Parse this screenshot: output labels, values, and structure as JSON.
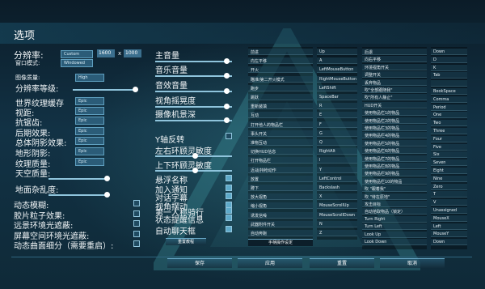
{
  "title": "选项",
  "video": {
    "resolution_label": "分辨率:",
    "resolution_mode": "Custom",
    "width": "1600",
    "x": "x",
    "height": "1000",
    "window_mode_label": "窗口模式:",
    "window_mode": "Windowed",
    "graphics_quality_label": "图像质量:",
    "graphics_quality": "High",
    "resolution_scale_label": "分辨率等级:"
  },
  "detail_settings": [
    {
      "label": "世界纹理缓存",
      "value": "Epic"
    },
    {
      "label": "视距:",
      "value": "Epic"
    },
    {
      "label": "抗锯齿:",
      "value": "Epic"
    },
    {
      "label": "后期效果:",
      "value": "Epic"
    },
    {
      "label": "总体阴影效果:",
      "value": "Epic"
    },
    {
      "label": "地形阴影:",
      "value": "Epic"
    },
    {
      "label": "纹理质量:",
      "value": "Epic"
    },
    {
      "label": "天空质量:",
      "value": ""
    },
    {
      "label": "地面杂乱度:",
      "value": ""
    }
  ],
  "left_toggles": [
    "动态模糊:",
    "胶片粒子效果:",
    "远景环境光遮蔽:",
    "屏幕空间环境光遮蔽:",
    "动态曲面细分（需要重启）:"
  ],
  "audio": [
    "主音量",
    "音乐音量",
    "音效音量",
    "视角摇晃度",
    "摄像机景深"
  ],
  "camera": {
    "invert_y": "Y轴反转",
    "lr_sensitivity": "左右环顾灵敏度",
    "ud_sensitivity": "上下环顾灵敏度"
  },
  "checkbox_options": [
    "悬浮名称",
    "加入通知",
    "对话字幕",
    "视角摆动",
    "第一人称骑行",
    "状态提醒信息",
    "自动聊天框"
  ],
  "reset_button": "重置教程",
  "controls_col1": [
    "前进",
    "向左平移",
    "开火",
    "瞄准/第二开火模式",
    "跑步",
    "跳跃",
    "重新装填",
    "互动",
    "打开他人的物品栏",
    "事头开关",
    "准物互动",
    "切换HUD信息",
    "打开物品栏",
    "近战/持枪动作",
    "放置",
    "蹲下",
    "放大视角",
    "缩小视角",
    "诱发信噪",
    "武器附件开关",
    "自动奔跑"
  ],
  "controls_col2": [
    "Up",
    "A",
    "LeftMouseButton",
    "RightMouseButton",
    "LeftShift",
    "SpaceBar",
    "R",
    "E",
    "F",
    "G",
    "Q",
    "RightAlt",
    "I",
    "Y",
    "LeftControl",
    "Backslash",
    "X",
    "MouseScrollUp",
    "MouseScrollDown",
    "N",
    "Z"
  ],
  "controls_col3": [
    "后退",
    "向右平移",
    "环境视角开关",
    "调整开关",
    "丢弃物品",
    "吹\"全部跟随我\"",
    "吹\"所有人静止\"",
    "HUD开关",
    "使用物品栏1的物品",
    "使用物品栏2的物品",
    "使用物品栏3的物品",
    "使用物品栏4的物品",
    "使用物品栏5的物品",
    "使用物品栏6的物品",
    "使用物品栏7的物品",
    "使用物品栏8的物品",
    "使用物品栏9的物品",
    "使用物品栏10的物品",
    "吹 \"跟着我\"",
    "吹 \"待在原地\"",
    "攻击目标",
    "自动拾取物品（锁定）",
    "Turn Right",
    "Turn Left",
    "Look Up",
    "Look Down"
  ],
  "controls_col4": [
    "Down",
    "D",
    "K",
    "Tab",
    "",
    "BookSpace",
    "Comma",
    "Period",
    "One",
    "Two",
    "Three",
    "Four",
    "Five",
    "Six",
    "Seven",
    "Eight",
    "Nine",
    "Zero",
    "T",
    "V",
    "Unassigned",
    "MouseX",
    "Left",
    "MouseY",
    "Down"
  ],
  "controller_button": "手柄操作设定",
  "bottom_buttons": [
    "保存",
    "应用",
    "重置",
    "取消"
  ]
}
